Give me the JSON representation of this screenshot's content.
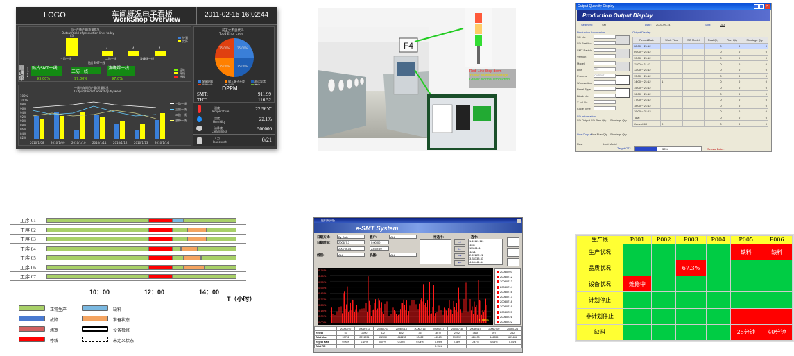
{
  "dashboard": {
    "logo": "LOGO",
    "title_cn": "车间概况电子看板",
    "title_en": "WorkShop Overview",
    "datetime": "2011-02-15 16:02:44",
    "output_title_cn": "当日产线产量/质量状况",
    "output_title_en": "Output/Yield of production lines today",
    "legend_plan": "计划",
    "legend_actual": "实际",
    "bar_labels": [
      "三阶一线",
      "二阶一线",
      "波峰焊一线"
    ],
    "bar_values": [
      "4",
      "83",
      "4",
      "4"
    ],
    "axis_label": "贴片SMT一线",
    "direct_rate_label": "直通率",
    "first_pass_label": "First pass",
    "lines": [
      "贴片SMT一线",
      "三防一线",
      "波峰焊一线"
    ],
    "percents": [
      "93.00%",
      "97.00%",
      "97.0%"
    ],
    "status_legend": [
      "运转",
      "停线",
      "待料"
    ],
    "weekly_title_cn": "一周内车间日产量/质量状况",
    "weekly_title_en": "Output/Yield of workshop by week",
    "y_ticks": [
      "102%",
      "100%",
      "98%",
      "96%",
      "94%",
      "92%",
      "90%",
      "88%",
      "86%",
      "84%",
      "82%"
    ],
    "x_ticks": [
      "2010/1/08",
      "2010/1/09",
      "2010/1/10",
      "2010/1/11",
      "2010/1/12",
      "2010/1/13",
      "2010/1/14"
    ],
    "weekly_legend": [
      "三防一线",
      "三阶一线",
      "二阶一线",
      "波峰一线"
    ],
    "error_title_cn": "前五大不良代码",
    "error_title_en": "Top5 Error code",
    "pie_pcts": [
      "25.00%",
      "25.00%",
      "25.00%",
      "25.00%"
    ],
    "error_legend": [
      "焊锡缺陷",
      "输入端子不良",
      "测试异常",
      "器件缺失",
      "少锡",
      "其它"
    ],
    "dppm_title": "DPPM",
    "smt_label": "SMT:",
    "smt_value": "911.99",
    "tht_label": "THT:",
    "tht_value": "116.52",
    "temp_label": "温度",
    "temp_label_en": "Temperature",
    "temp_value": "22.56℃",
    "hum_label": "湿度",
    "hum_label_en": "Humidity",
    "hum_value": "22.1%",
    "clean_label": "洁净度",
    "clean_label_en": "Cleanliness",
    "clean_value": "500000",
    "head_label": "人力",
    "head_label_en": "Headcount",
    "head_value": "0/21",
    "colors": {
      "bg": "#3b3b3b",
      "yellow": "#ffff00",
      "blue": "#3a7fd8",
      "green": "#7cfc00"
    }
  },
  "photo": {
    "station_sign": "F4",
    "callout_red": "Red: Line Stop down",
    "callout_yellow": "Yellow: Material shortage",
    "callout_green": "Green: Normal Production"
  },
  "output_display": {
    "window_title": "Output Quantity Display",
    "banner": "Production Output Display",
    "segment_label": "Segment:",
    "segment_value": "SMT",
    "date_label": "Date:",
    "date_value": "2007-09-14",
    "shift_label": "Shift:",
    "shift_value": "DAY",
    "prod_info": "Production Information",
    "fields": [
      "SO No.",
      "SO Part No.",
      "SMT PartNo.",
      "Version",
      "Model",
      "Line",
      "Process",
      "Workstation",
      "Panel Type",
      "Block No.",
      "X-sol No.",
      "Cycle Time"
    ],
    "field_values": [
      "",
      "",
      "",
      "",
      "",
      "SE1",
      "OUTPUT",
      "",
      "",
      "",
      "",
      ""
    ],
    "output_display_label": "Output Display",
    "headers": [
      "Period/Date",
      "Work Time",
      "SO Model",
      "Real Qty",
      "Plan Qty",
      "Shortage Qty"
    ],
    "rows": [
      [
        "08:00 ~ 21:12",
        "",
        "",
        "0",
        "0",
        "0"
      ],
      [
        "09:00 ~ 21:12",
        "",
        "",
        "0",
        "0",
        "0"
      ],
      [
        "10:00 ~ 21:12",
        "",
        "",
        "0",
        "0",
        "0"
      ],
      [
        "11:00 ~ 21:12",
        "",
        "",
        "0",
        "0",
        "0"
      ],
      [
        "12:00 ~ 21:12",
        "",
        "",
        "0",
        "0",
        "0"
      ],
      [
        "13:00 ~ 21:12",
        "",
        "",
        "0",
        "0",
        "0"
      ],
      [
        "14:00 ~ 21:12",
        "1",
        "",
        "0",
        "0",
        "0"
      ],
      [
        "15:00 ~ 21:12",
        "",
        "",
        "0",
        "0",
        "0"
      ],
      [
        "16:00 ~ 21:12",
        "",
        "",
        "0",
        "0",
        "0"
      ],
      [
        "17:00 ~ 21:12",
        "",
        "",
        "0",
        "0",
        "0"
      ],
      [
        "18:00 ~ 21:12",
        "",
        "",
        "0",
        "0",
        "0"
      ],
      [
        "19:00 ~ 21:12",
        "",
        "",
        "0",
        "0",
        "0"
      ],
      [
        "Total",
        "",
        "",
        "0",
        "0",
        "0"
      ],
      [
        "CurrentSO",
        "0",
        "",
        "0",
        "0",
        "0"
      ]
    ],
    "so_info": "SO Information",
    "so_cols": [
      "SO Output",
      "SO Plan Qty",
      "Shortage Qty"
    ],
    "line_output": "Line Output",
    "line_cols": [
      "Line Plan Qty",
      "Shortage Qty"
    ],
    "rest_label": "Rest",
    "last_model": "Last Model",
    "target_label": "Target OT1",
    "progress_pct": 33,
    "progress_text": "33%",
    "sensor_label": "Sensor Date :"
  },
  "gantt": {
    "rows": [
      "工序 01",
      "工序 02",
      "工序 03",
      "工序 04",
      "工序 05",
      "工序 06",
      "工序 07"
    ],
    "times": [
      "10：00",
      "12：00",
      "14：00"
    ],
    "axis_unit": "T（小时）",
    "legend": [
      "正常生产",
      "缺料",
      "故障",
      "准备状态",
      "堵塞",
      "设备检修",
      "停线",
      "未定义状态"
    ]
  },
  "esmt": {
    "window_title": "贴料率分析",
    "banner": "e-SMT System",
    "date_mode_label": "日期方式:",
    "date_mode_value": "By Date",
    "customer_label": "客户:",
    "customer_value": "ALL",
    "date_range_label": "日期时间:",
    "date_from": "2006-7-7",
    "time_from": "0:00:00",
    "date_to": "2007-8-14",
    "time_to": "23:59:59",
    "line_label": "线别:",
    "line_value": "ALL",
    "machine_label": "机器:",
    "machine_value": "ALL",
    "pending_label": "待选中:",
    "selected_label": "选中:",
    "selected_values": [
      "1.11111.111",
      "1111",
      "11111111",
      "1221",
      "2.22222.22",
      "3.33333.33",
      "4.44444.44"
    ],
    "y_ticks": [
      "0.74%",
      "0.65%",
      "0.55%",
      "0.55%",
      "0.46%",
      "0.37%",
      "0.28%",
      "0.18%",
      "0.09%",
      "0.00%"
    ],
    "legend_items": [
      "20060707",
      "20060712",
      "20060713",
      "20060714",
      "20060716",
      "20060717",
      "20060718",
      "20060719",
      "20060720",
      "20060721",
      "20060722"
    ],
    "peak_label": "0.08%",
    "table_dates": [
      "",
      "20060707",
      "20060712",
      "20060713",
      "20060714",
      "20060716",
      "20060717",
      "20060718",
      "20060719",
      "20060720",
      "20060721"
    ],
    "table_rows": [
      [
        "Reject",
        "53",
        "2200",
        "372",
        "842",
        "35",
        "3077",
        "2242",
        "3884",
        "207",
        "262"
      ],
      [
        "Total Use",
        "59751",
        "2374234",
        "532030",
        "1061235",
        "90422",
        "445420",
        "590592",
        "824130",
        "446855",
        "607466"
      ],
      [
        "Reject Rate",
        "0.09%",
        "0.10%",
        "0.07%",
        "0.08%",
        "0.04%",
        "0.69%",
        "0.38%",
        "0.47%",
        "0.05%",
        "0.04%"
      ],
      [
        "Total RR",
        "",
        "",
        "",
        "",
        "",
        "0.11%",
        "",
        "",
        "",
        ""
      ]
    ]
  },
  "status_grid": {
    "headers": [
      "生产线",
      "P001",
      "P002",
      "P003",
      "P004",
      "P005",
      "P006"
    ],
    "rows": [
      [
        "生产状况",
        "",
        "",
        "",
        "",
        "缺料",
        "缺料"
      ],
      [
        "品质状况",
        "",
        "",
        "67.3%",
        "",
        "",
        ""
      ],
      [
        "设备状况",
        "维修中",
        "",
        "",
        "",
        "",
        ""
      ],
      [
        "计划停止",
        "",
        "",
        "",
        "",
        "",
        ""
      ],
      [
        "非计划停止",
        "",
        "",
        "",
        "",
        "",
        ""
      ],
      [
        "缺料",
        "",
        "",
        "",
        "",
        "25分钟",
        "40分钟"
      ]
    ],
    "cell_states": [
      [
        "g",
        "g",
        "g",
        "g",
        "r",
        "r"
      ],
      [
        "g",
        "g",
        "r",
        "g",
        "g",
        "g"
      ],
      [
        "r",
        "g",
        "g",
        "g",
        "g",
        "g"
      ],
      [
        "g",
        "g",
        "g",
        "g",
        "g",
        "g"
      ],
      [
        "g",
        "g",
        "g",
        "g",
        "r",
        "r"
      ],
      [
        "g",
        "g",
        "g",
        "g",
        "r",
        "r"
      ]
    ],
    "colors": {
      "header": "#ffff33",
      "ok": "#00cc44",
      "alert": "#ff0000"
    }
  }
}
